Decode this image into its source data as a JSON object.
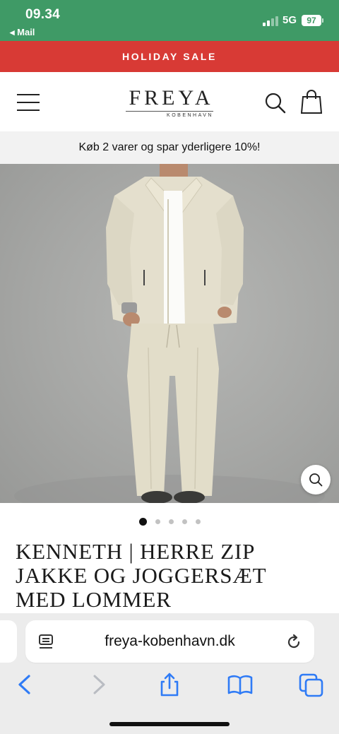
{
  "status_bar": {
    "time": "09.34",
    "back_app": "◂ Mail",
    "network": "5G",
    "battery": "97"
  },
  "promo_banner": {
    "text": "HOLIDAY SALE"
  },
  "header": {
    "logo_text": "FREYA",
    "logo_subtext": "KOBENHAVN"
  },
  "offer_bar": {
    "text": "Køb 2 varer og spar yderligere 10%!"
  },
  "carousel": {
    "dot_count": 5,
    "active_index": 0
  },
  "product": {
    "title_lines": [
      "KENNETH | HERRE ZIP",
      "JAKKE OG JOGGERSÆT",
      "MED LOMMER"
    ]
  },
  "browser": {
    "address": "freya-kobenhavn.dk"
  },
  "icons": {
    "menu": "hamburger-icon",
    "search": "search-icon",
    "bag": "shopping-bag-icon",
    "zoom": "zoom-icon",
    "page_format": "page-format-icon",
    "reload": "reload-icon",
    "back": "chevron-left-icon",
    "forward": "chevron-right-icon",
    "share": "share-icon",
    "bookmarks": "book-icon",
    "tabs": "tabs-icon"
  },
  "colors": {
    "status_bar": "#3f9a66",
    "promo_banner": "#d83a35",
    "safari_blue": "#2f7bf6"
  }
}
